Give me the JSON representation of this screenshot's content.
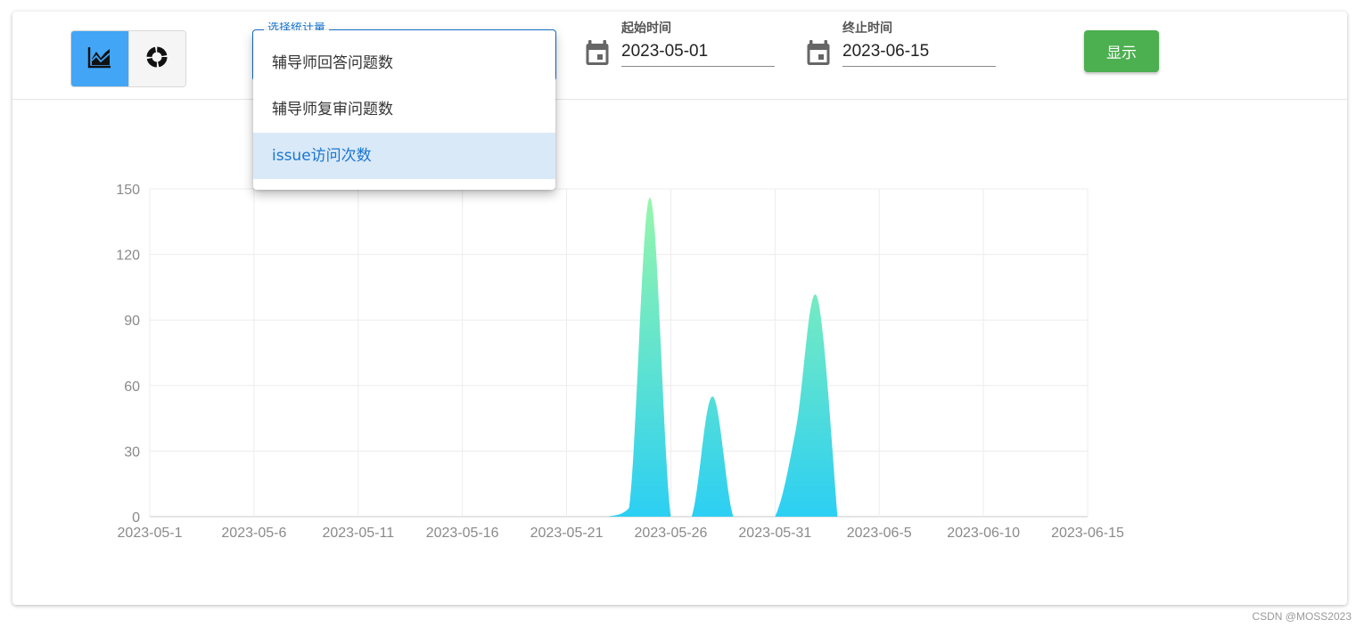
{
  "toolbar": {
    "chart_type_buttons": [
      {
        "icon": "area-chart-icon",
        "active": true
      },
      {
        "icon": "donut-chart-icon",
        "active": false
      }
    ],
    "select_label": "选择统计量",
    "start_date": {
      "label": "起始时间",
      "value": "2023-05-01",
      "icon": "calendar-icon"
    },
    "end_date": {
      "label": "终止时间",
      "value": "2023-06-15",
      "icon": "calendar-icon"
    },
    "show_label": "显示",
    "show_color": "#4caf50",
    "accent_color": "#42a5f5"
  },
  "dropdown": {
    "items": [
      "辅导师回答问题数",
      "辅导师复审问题数",
      "issue访问次数"
    ],
    "selected": "issue访问次数"
  },
  "chart_data": {
    "type": "area",
    "x_ticks": [
      "2023-05-1",
      "2023-05-6",
      "2023-05-11",
      "2023-05-16",
      "2023-05-21",
      "2023-05-26",
      "2023-05-31",
      "2023-06-5",
      "2023-06-10",
      "2023-06-15"
    ],
    "y_ticks": [
      0,
      30,
      60,
      90,
      120,
      150
    ],
    "ylim": [
      0,
      150
    ],
    "xlim": [
      "2023-05-01",
      "2023-06-15"
    ],
    "x": [
      "2023-05-23",
      "2023-05-24",
      "2023-05-25",
      "2023-05-26",
      "2023-05-27",
      "2023-05-28",
      "2023-05-29",
      "2023-05-30",
      "2023-05-31",
      "2023-06-01",
      "2023-06-02",
      "2023-06-03"
    ],
    "values": [
      0,
      4,
      146,
      0,
      0,
      55,
      0,
      0,
      0,
      40,
      101,
      0
    ],
    "grid": true,
    "gradient": [
      "#96f7ab",
      "#2ccff3"
    ]
  },
  "watermark": "CSDN @MOSS2023"
}
